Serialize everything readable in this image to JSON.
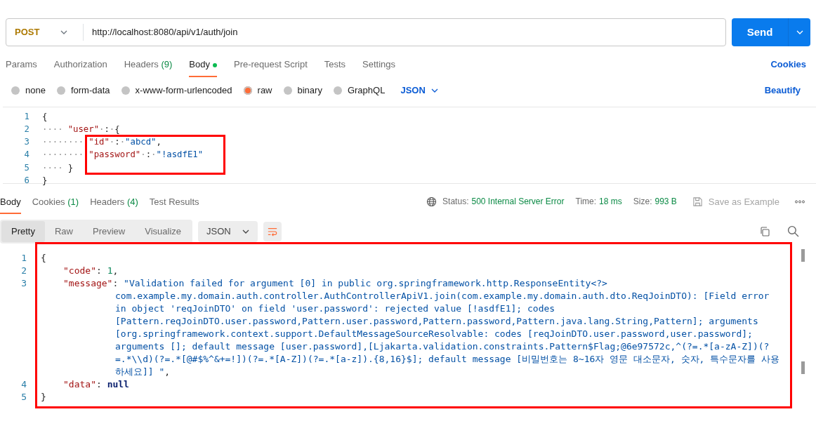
{
  "request": {
    "method": "POST",
    "url": "http://localhost:8080/api/v1/auth/join",
    "send": "Send"
  },
  "request_tabs": [
    {
      "label": "Params",
      "selected": false,
      "has_content": false
    },
    {
      "label": "Authorization",
      "selected": false,
      "has_content": false
    },
    {
      "label": "Headers",
      "count": "(9)",
      "selected": false,
      "has_content": false
    },
    {
      "label": "Body",
      "selected": true,
      "has_content": true
    },
    {
      "label": "Pre-request Script",
      "selected": false,
      "has_content": false
    },
    {
      "label": "Tests",
      "selected": false,
      "has_content": false
    },
    {
      "label": "Settings",
      "selected": false,
      "has_content": false
    }
  ],
  "cookies_link": "Cookies",
  "body_types": [
    {
      "label": "none",
      "selected": false
    },
    {
      "label": "form-data",
      "selected": false
    },
    {
      "label": "x-www-form-urlencoded",
      "selected": false
    },
    {
      "label": "raw",
      "selected": true
    },
    {
      "label": "binary",
      "selected": false
    },
    {
      "label": "GraphQL",
      "selected": false
    }
  ],
  "body_format": "JSON",
  "beautify": "Beautify",
  "request_body": {
    "highlight": true,
    "lines": [
      {
        "number": "1",
        "tokens": [
          {
            "kind": "punct",
            "text": "{"
          }
        ]
      },
      {
        "number": "2",
        "tokens": [
          {
            "kind": "ws",
            "text": "····"
          },
          {
            "kind": "key",
            "text": "\"user\""
          },
          {
            "kind": "ws",
            "text": "·"
          },
          {
            "kind": "punct",
            "text": ":"
          },
          {
            "kind": "ws",
            "text": "·"
          },
          {
            "kind": "punct",
            "text": "{"
          }
        ]
      },
      {
        "number": "3",
        "tokens": [
          {
            "kind": "ws",
            "text": "········"
          },
          {
            "kind": "key",
            "text": "\"id\""
          },
          {
            "kind": "ws",
            "text": "·"
          },
          {
            "kind": "punct",
            "text": ":"
          },
          {
            "kind": "ws",
            "text": "·"
          },
          {
            "kind": "string",
            "text": "\"abcd\""
          },
          {
            "kind": "punct",
            "text": ","
          }
        ]
      },
      {
        "number": "4",
        "tokens": [
          {
            "kind": "ws",
            "text": "········"
          },
          {
            "kind": "key",
            "text": "\"password\""
          },
          {
            "kind": "ws",
            "text": "·"
          },
          {
            "kind": "punct",
            "text": ":"
          },
          {
            "kind": "ws",
            "text": "·"
          },
          {
            "kind": "string",
            "text": "\"!asdfE1\""
          }
        ]
      },
      {
        "number": "5",
        "tokens": [
          {
            "kind": "ws",
            "text": "····"
          },
          {
            "kind": "punct",
            "text": "}"
          }
        ]
      },
      {
        "number": "6",
        "tokens": [
          {
            "kind": "punct",
            "text": "}"
          }
        ]
      }
    ]
  },
  "response_tabs": [
    {
      "label": "Body",
      "selected": true
    },
    {
      "label": "Cookies",
      "count": "(1)",
      "selected": false
    },
    {
      "label": "Headers",
      "count": "(4)",
      "selected": false
    },
    {
      "label": "Test Results",
      "selected": false
    }
  ],
  "response_meta": [
    {
      "label": "Status:",
      "value": "500 Internal Server Error"
    },
    {
      "label": "Time:",
      "value": "18 ms"
    },
    {
      "label": "Size:",
      "value": "993 B"
    }
  ],
  "save_as_example": {
    "label": "Save as Example",
    "disabled": true
  },
  "view_tabs": [
    {
      "label": "Pretty",
      "selected": true
    },
    {
      "label": "Raw",
      "selected": false
    },
    {
      "label": "Preview",
      "selected": false
    },
    {
      "label": "Visualize",
      "selected": false
    }
  ],
  "response_format": "JSON",
  "response_body": {
    "highlight": true,
    "lines": [
      {
        "number": "1",
        "tokens": [
          {
            "kind": "punct",
            "text": "{"
          }
        ]
      },
      {
        "number": "2",
        "indent": true,
        "tokens": [
          {
            "kind": "key",
            "text": "\"code\""
          },
          {
            "kind": "punct",
            "text": ": "
          },
          {
            "kind": "number",
            "text": "1"
          },
          {
            "kind": "punct",
            "text": ","
          }
        ]
      },
      {
        "number": "3",
        "indent": true,
        "tokens": [
          {
            "kind": "key",
            "text": "\"message\""
          },
          {
            "kind": "punct",
            "text": ": "
          },
          {
            "kind": "string",
            "text": "\"Validation failed for argument [0] in public org.springframework.http.ResponseEntity<?> com.example.my.domain.auth.controller.AuthControllerApiV1.join(com.example.my.domain.auth.dto.ReqJoinDTO): [Field error in object 'reqJoinDTO' on field 'user.password': rejected value [!asdfE1]; codes [Pattern.reqJoinDTO.user.password,Pattern.user.password,Pattern.password,Pattern.java.lang.String,Pattern]; arguments [org.springframework.context.support.DefaultMessageSourceResolvable: codes [reqJoinDTO.user.password,user.password]; arguments []; default message [user.password],[Ljakarta.validation.constraints.Pattern$Flag;@6e97572c,^(?=.*[a-zA-Z])(?=.*\\\\d)(?=.*[@#$%^&+=!])(?=.*[A-Z])(?=.*[a-z]).{8,16}$]; default message [비밀번호는 8~16자 영문 대소문자, 숫자, 특수문자를 사용하세요]] \""
          },
          {
            "kind": "punct",
            "text": ","
          }
        ]
      },
      {
        "number": "4",
        "indent": true,
        "tokens": [
          {
            "kind": "key",
            "text": "\"data\""
          },
          {
            "kind": "punct",
            "text": ": "
          },
          {
            "kind": "keyword",
            "text": "null"
          }
        ]
      },
      {
        "number": "5",
        "tokens": [
          {
            "kind": "punct",
            "text": "}"
          }
        ]
      }
    ]
  }
}
